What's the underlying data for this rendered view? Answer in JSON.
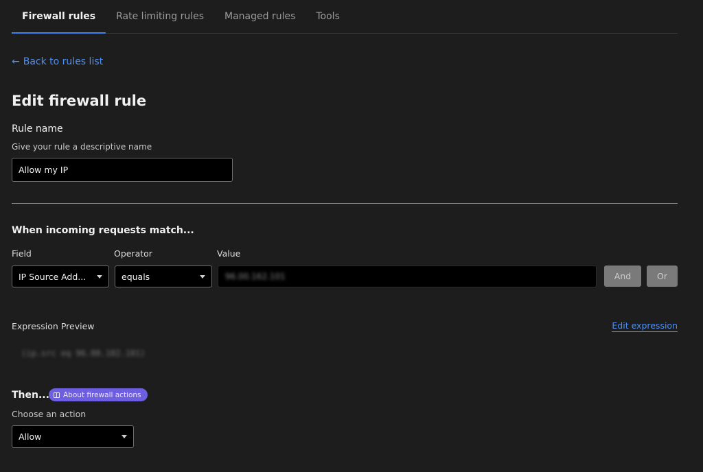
{
  "tabs": [
    {
      "label": "Firewall rules",
      "active": true
    },
    {
      "label": "Rate limiting rules",
      "active": false
    },
    {
      "label": "Managed rules",
      "active": false
    },
    {
      "label": "Tools",
      "active": false
    }
  ],
  "back_link": {
    "arrow": "←",
    "label": "Back to rules list"
  },
  "page_title": "Edit firewall rule",
  "rule_name": {
    "label": "Rule name",
    "help": "Give your rule a descriptive name",
    "value": "Allow my IP"
  },
  "match": {
    "title": "When incoming requests match...",
    "field_label": "Field",
    "operator_label": "Operator",
    "value_label": "Value",
    "field_value": "IP Source Add...",
    "operator_value": "equals",
    "value_value": "96.00.162.101",
    "and_label": "And",
    "or_label": "Or"
  },
  "expression": {
    "label": "Expression Preview",
    "edit_label": "Edit expression",
    "preview": "(ip.src eq 96.00.102.101)"
  },
  "then": {
    "title": "Then...",
    "badge_label": "About firewall actions",
    "help": "Choose an action",
    "action_value": "Allow"
  },
  "colors": {
    "background": "#1d1d1d",
    "accent": "#3b82f6",
    "link": "#4c8ff6",
    "badge": "#6e5fe0"
  }
}
